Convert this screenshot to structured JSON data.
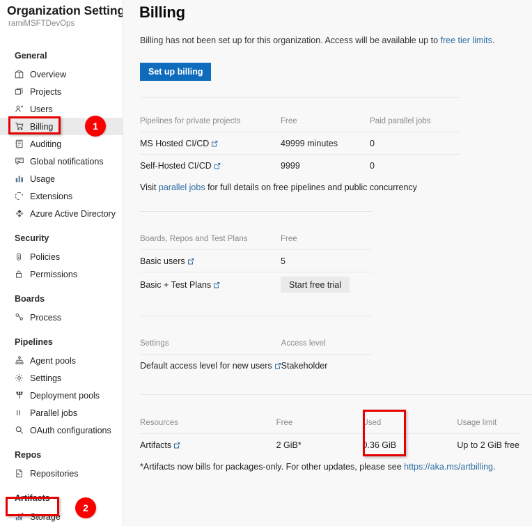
{
  "sidebar": {
    "org_title": "Organization Settings",
    "org_name": "ramiMSFTDevOps",
    "groups": [
      {
        "title": "General",
        "items": [
          {
            "label": "Overview",
            "icon": "overview-icon"
          },
          {
            "label": "Projects",
            "icon": "projects-icon"
          },
          {
            "label": "Users",
            "icon": "users-icon"
          },
          {
            "label": "Billing",
            "icon": "billing-cart-icon",
            "selected": true
          },
          {
            "label": "Auditing",
            "icon": "auditing-icon"
          },
          {
            "label": "Global notifications",
            "icon": "notifications-icon"
          },
          {
            "label": "Usage",
            "icon": "usage-chart-icon"
          },
          {
            "label": "Extensions",
            "icon": "extensions-icon"
          },
          {
            "label": "Azure Active Directory",
            "icon": "azure-ad-icon"
          }
        ]
      },
      {
        "title": "Security",
        "items": [
          {
            "label": "Policies",
            "icon": "policies-icon"
          },
          {
            "label": "Permissions",
            "icon": "permissions-lock-icon"
          }
        ]
      },
      {
        "title": "Boards",
        "items": [
          {
            "label": "Process",
            "icon": "process-icon"
          }
        ]
      },
      {
        "title": "Pipelines",
        "items": [
          {
            "label": "Agent pools",
            "icon": "agent-pools-icon"
          },
          {
            "label": "Settings",
            "icon": "gear-icon"
          },
          {
            "label": "Deployment pools",
            "icon": "deployment-pools-icon"
          },
          {
            "label": "Parallel jobs",
            "icon": "parallel-jobs-icon"
          },
          {
            "label": "OAuth configurations",
            "icon": "oauth-key-icon"
          }
        ]
      },
      {
        "title": "Repos",
        "items": [
          {
            "label": "Repositories",
            "icon": "repositories-icon"
          }
        ]
      },
      {
        "title": "Artifacts",
        "items": [
          {
            "label": "Storage",
            "icon": "storage-chart-icon"
          }
        ]
      }
    ]
  },
  "main": {
    "page_title": "Billing",
    "intro_text": "Billing has not been set up for this organization. Access will be available up to ",
    "intro_link": "free tier limits",
    "intro_tail": ".",
    "setup_button": "Set up billing",
    "section_pipelines": {
      "headers": [
        "Pipelines for private projects",
        "Free",
        "Paid parallel jobs"
      ],
      "rows": [
        {
          "name": "MS Hosted CI/CD",
          "external": true,
          "free": "49999 minutes",
          "paid": "0"
        },
        {
          "name": "Self-Hosted CI/CD",
          "external": true,
          "free": "9999",
          "paid": "0"
        }
      ],
      "note_before": "Visit ",
      "note_link": "parallel jobs",
      "note_after": " for full details on free pipelines and public concurrency"
    },
    "section_boards": {
      "headers": [
        "Boards, Repos and Test Plans",
        "Free"
      ],
      "rows": [
        {
          "name": "Basic users",
          "external": true,
          "free": "5",
          "button": null
        },
        {
          "name": "Basic + Test Plans",
          "external": true,
          "free": null,
          "button": "Start free trial"
        }
      ]
    },
    "section_settings": {
      "headers": [
        "Settings",
        "Access level"
      ],
      "rows": [
        {
          "name": "Default access level for new users",
          "external": true,
          "value": "Stakeholder"
        }
      ]
    },
    "section_resources": {
      "headers": [
        "Resources",
        "Free",
        "Used",
        "Usage limit"
      ],
      "rows": [
        {
          "name": "Artifacts",
          "external": true,
          "free": "2 GiB*",
          "used": "0.36 GiB",
          "limit": "Up to 2 GiB free"
        }
      ],
      "note_before": "*Artifacts now bills for packages-only. For other updates, please see ",
      "note_link": "https://aka.ms/artbilling",
      "note_after": "."
    }
  },
  "annotations": {
    "badge_1": "1",
    "badge_2": "2",
    "highlight_color": "#e60000",
    "badge_color": "#fa0000"
  }
}
